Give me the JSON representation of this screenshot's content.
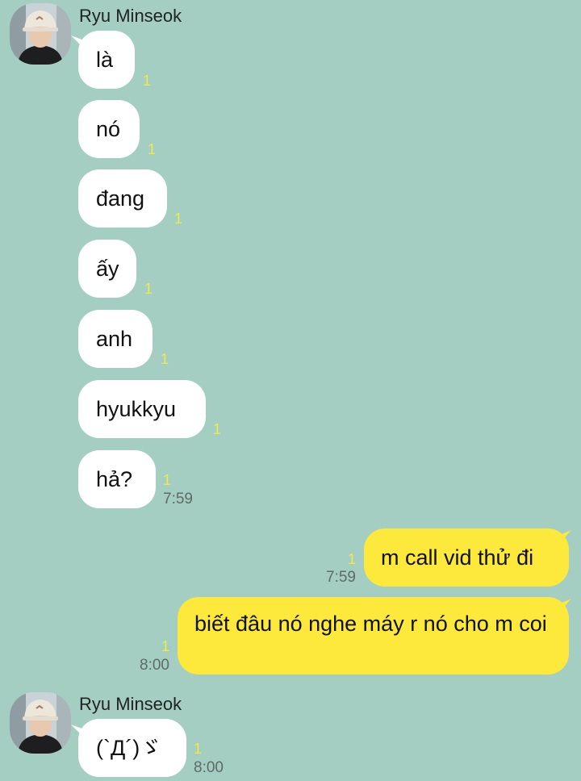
{
  "chat": {
    "groups": [
      {
        "sender": "Ryu Minseok",
        "messages": [
          {
            "text": "là",
            "unread": "1"
          },
          {
            "text": "nó",
            "unread": "1"
          },
          {
            "text": "đang",
            "unread": "1"
          },
          {
            "text": "ấy",
            "unread": "1"
          },
          {
            "text": "anh",
            "unread": "1"
          },
          {
            "text": "hyukkyu",
            "unread": "1"
          },
          {
            "text": "hả?",
            "unread": "1",
            "time": "7:59"
          }
        ]
      },
      {
        "sender": "me",
        "messages": [
          {
            "text": "m call vid thử đi",
            "unread": "1",
            "time": "7:59"
          },
          {
            "text": "biết đâu nó nghe máy r nó cho m coi",
            "unread": "1",
            "time": "8:00"
          }
        ]
      },
      {
        "sender": "Ryu Minseok",
        "messages": [
          {
            "text": "(`Д´)ゞ",
            "unread": "1",
            "time": "8:00"
          }
        ]
      }
    ]
  },
  "colors": {
    "background": "#a4cec1",
    "incoming_bubble": "#ffffff",
    "outgoing_bubble": "#fde93b",
    "unread_count": "#f2e94a",
    "time": "#5f6b66"
  }
}
